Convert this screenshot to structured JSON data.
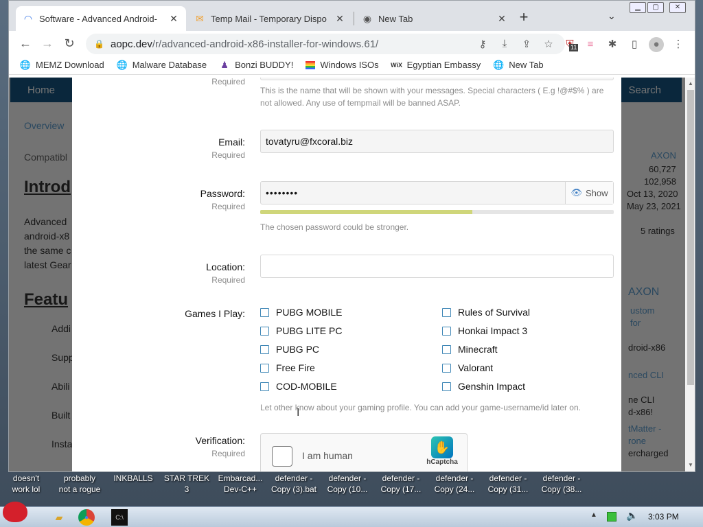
{
  "browser": {
    "tabs": [
      {
        "label": "Software - Advanced Android-",
        "icon": "spinner-icon",
        "active": true
      },
      {
        "label": "Temp Mail - Temporary Dispo",
        "icon": "tempmail-icon",
        "active": false
      },
      {
        "label": "New Tab",
        "icon": "chrome-icon",
        "active": false
      }
    ],
    "close_glyph": "✕",
    "newtab_glyph": "+",
    "tabsearch_glyph": "⌄",
    "url_host": "aopc.dev",
    "url_path": "/r/advanced-android-x86-installer-for-windows.61/",
    "extension_badge": "11",
    "bookmarks": [
      {
        "label": "MEMZ Download",
        "icon": "globe-icon"
      },
      {
        "label": "Malware Database",
        "icon": "globe-icon"
      },
      {
        "label": "Bonzi BUDDY!",
        "icon": "bonzi-icon"
      },
      {
        "label": "Windows ISOs",
        "icon": "windows-flag-icon"
      },
      {
        "label": "Egyptian Embassy",
        "icon": "wix-icon"
      },
      {
        "label": "New Tab",
        "icon": "globe-icon"
      }
    ]
  },
  "site": {
    "nav_home": "Home",
    "nav_search": "Search",
    "bg_left": [
      "Overview",
      "Compatibl",
      "Introd",
      "Advanced",
      "android-x8",
      "the same c",
      "latest Gear",
      "Featu",
      "Addi",
      "Supp",
      "Abili",
      "Built",
      "Insta"
    ],
    "bg_right": [
      "AXON",
      "60,727",
      "102,958",
      "Oct 13, 2020",
      "May 23, 2021",
      "5 ratings",
      "AXON",
      "ustom",
      "for",
      "droid-x86",
      "nced CLI",
      "ne CLI",
      "d-x86!",
      "tMatter -",
      "rone",
      "ercharged"
    ]
  },
  "form": {
    "required_label": "Required",
    "name_hint": "This is the name that will be shown with your messages. Special characters ( E.g !@#$% ) are not allowed. Any use of tempmail will be banned ASAP.",
    "email_label": "Email:",
    "email_value": "tovatyru@fxcoral.biz",
    "password_label": "Password:",
    "password_value": "••••••••",
    "password_show": "Show",
    "password_strength": 0.6,
    "password_hint": "The chosen password could be stronger.",
    "location_label": "Location:",
    "location_value": "",
    "games_label": "Games I Play:",
    "games_left": [
      "PUBG MOBILE",
      "PUBG LITE PC",
      "PUBG PC",
      "Free Fire",
      "COD-MOBILE"
    ],
    "games_right": [
      "Rules of Survival",
      "Honkai Impact 3",
      "Minecraft",
      "Valorant",
      "Genshin Impact"
    ],
    "games_hint": "Let other know about your gaming profile. You can add your game-username/id later on.",
    "verification_label": "Verification:",
    "captcha_text": "I am human",
    "captcha_brand": "hCaptcha"
  },
  "desktop": {
    "icons": [
      {
        "line1": "doesn't",
        "line2": "work lol"
      },
      {
        "line1": "probably",
        "line2": "not a rogue"
      },
      {
        "line1": "INKBALLS",
        "line2": ""
      },
      {
        "line1": "STAR TREK",
        "line2": "3"
      },
      {
        "line1": "Embarcad...",
        "line2": "Dev-C++"
      },
      {
        "line1": "defender -",
        "line2": "Copy (3).bat"
      },
      {
        "line1": "defender -",
        "line2": "Copy (10..."
      },
      {
        "line1": "defender -",
        "line2": "Copy (17..."
      },
      {
        "line1": "defender -",
        "line2": "Copy (24..."
      },
      {
        "line1": "defender -",
        "line2": "Copy (31..."
      },
      {
        "line1": "defender -",
        "line2": "Copy (38..."
      }
    ],
    "clock": "3:03 PM"
  }
}
